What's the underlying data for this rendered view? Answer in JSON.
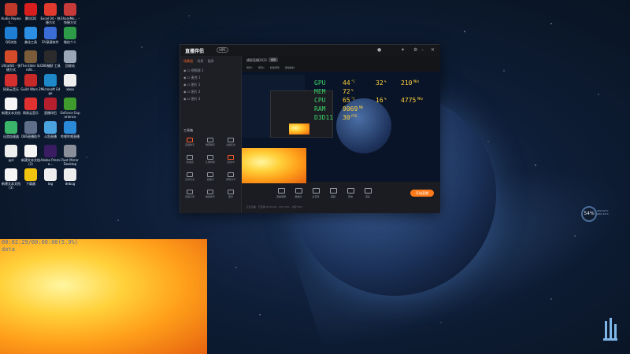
{
  "desktop_icons": [
    {
      "name": "audio-recorder",
      "label": "Audio Repeat...",
      "color": "#c0392b",
      "x": 0
    },
    {
      "name": "zhushou",
      "label": "腾讯QQ",
      "color": "#d91e1e"
    },
    {
      "name": "ksc-app",
      "label": "Excel 04 - 快捷方式",
      "color": "#e23b2e"
    },
    {
      "name": "sharemouse",
      "label": "ShareMo... - 快捷方式",
      "color": "#c63a3a"
    },
    {
      "name": "qq-browser",
      "label": "QQ浏览",
      "color": "#1f7fd4"
    },
    {
      "name": "uc-tool",
      "label": "美化工具",
      "color": "#2c8fe3"
    },
    {
      "name": "lurecord",
      "label": "EV录屏软件",
      "color": "#3a6dd6"
    },
    {
      "name": "weixin",
      "label": "微信个人",
      "color": "#2e9b49"
    },
    {
      "name": "ultraiso",
      "label": "UltraISO - 快捷方式",
      "color": "#d44b2a"
    },
    {
      "name": "elder-scrolls",
      "label": "The Elder Scrolls...",
      "color": "#7a5b3a"
    },
    {
      "name": "obs",
      "label": "OBS捕获 工具",
      "color": "#2b2b2b"
    },
    {
      "name": "recycle-bin",
      "label": "回收站",
      "color": "#9aa7b8"
    },
    {
      "name": "wangyi-cloud",
      "label": "网易云音乐",
      "color": "#d42f2f"
    },
    {
      "name": "anydesk-game",
      "label": "Guild Wars 2",
      "color": "#c72828"
    },
    {
      "name": "edge",
      "label": "Microsoft Edge",
      "color": "#1e88c9"
    },
    {
      "name": "xlsx-file",
      "label": "xboo",
      "color": "#eeeeee"
    },
    {
      "name": "doc-file",
      "label": "新建文本文档",
      "color": "#f5f5f5"
    },
    {
      "name": "netease-music",
      "label": "网易云音乐",
      "color": "#e03131"
    },
    {
      "name": "douyin",
      "label": "直播伴侣",
      "color": "#b51f2e"
    },
    {
      "name": "geforce",
      "label": "GeForce Experience",
      "color": "#3e9b2c"
    },
    {
      "name": "game-app",
      "label": "迅游加速器",
      "color": "#3bb56a"
    },
    {
      "name": "live-app",
      "label": "OBS直播助手",
      "color": "#5f6f8a"
    },
    {
      "name": "ds-app",
      "label": "斗鱼直播",
      "color": "#4aa3df"
    },
    {
      "name": "bilibili",
      "label": "哔哩哔哩直播",
      "color": "#2b8ad8"
    },
    {
      "name": "ppt-file",
      "label": "ppt",
      "color": "#eeeeee"
    },
    {
      "name": "txt-file",
      "label": "新建文本文档 (2)",
      "color": "#f5f5f5"
    },
    {
      "name": "premiere",
      "label": "Adobe Premie...",
      "color": "#3a1c63"
    },
    {
      "name": "rust-app",
      "label": "Rust Mirror Desktop",
      "color": "#8a8f99"
    },
    {
      "name": "txt-file-3",
      "label": "新建文本文档 (3)",
      "color": "#f5f5f5"
    },
    {
      "name": "fire-app",
      "label": "下载器",
      "color": "#f1c40f"
    },
    {
      "name": "log-file",
      "label": "log",
      "color": "#eeeeee"
    },
    {
      "name": "debug-file",
      "label": "debug",
      "color": "#eeeeee"
    }
  ],
  "app": {
    "logo": "直播伴侣",
    "vip": "VIP1",
    "tabs": [
      "场景组",
      "场景",
      "截屏"
    ],
    "sources": [
      "视频源 1",
      "麦克 1",
      "图片 1",
      "图片 2",
      "图片 3"
    ],
    "tools_title": "工具箱",
    "tools": [
      "直播助手",
      "弹幕助手",
      "主播任务",
      "粉丝团",
      "礼物特效",
      "连线PK",
      "互动玩法",
      "直播间",
      "屏幕共享",
      "直播记录",
      "看播助手",
      "更多"
    ],
    "scene_title": "横屏直播2021",
    "scene_tag": "横屏",
    "chips": [
      "场景1",
      "场景2",
      "新建场景",
      "添加素材"
    ],
    "bottom_items": [
      "直播录屏",
      "摄像头",
      "麦克风",
      "美颜",
      "音效",
      "连麦"
    ],
    "live_button": "开始直播",
    "status_line": "· 正在直播   ·  已直播 00:00:09  ·  CPU:12%  ·  内存:50%"
  },
  "hw_monitor": {
    "rows": [
      {
        "label": "GPU",
        "v1": "44",
        "u1": "°C",
        "v2": "32",
        "u2": "%",
        "v3": "210",
        "u3": "MHz"
      },
      {
        "label": "MEM",
        "v1": "72",
        "u1": "%"
      },
      {
        "label": "CPU",
        "v1": "65",
        "u1": "°C",
        "v2": "16",
        "u2": "%",
        "v3": "4775",
        "u3": "MHz"
      },
      {
        "label": "RAM",
        "v1": "9069",
        "u1": "MB"
      },
      {
        "label": "D3D11",
        "v1": "30",
        "u1": "FPS"
      }
    ]
  },
  "overlay": {
    "time_text": "00:02:29/00:00:00(5.9%)",
    "name_text": "dota"
  },
  "widget": {
    "gauge_value": "54%",
    "line1": "CPU 62°C",
    "line2": "GPU 44°C"
  }
}
